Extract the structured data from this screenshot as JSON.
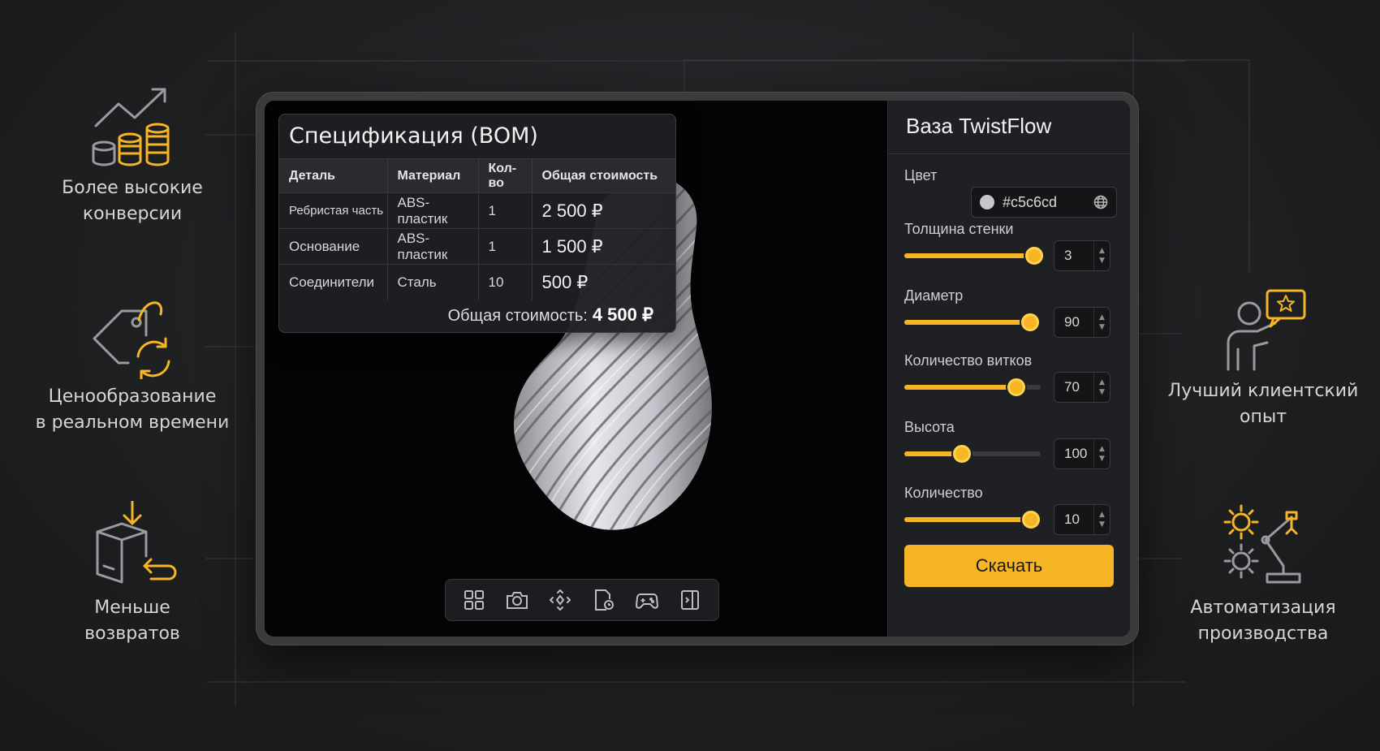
{
  "features_left": [
    {
      "label": "Более высокие\nконверсии",
      "icon": "coins-growth-icon"
    },
    {
      "label": "Ценообразование\nв реальном времени",
      "icon": "price-tag-refresh-icon"
    },
    {
      "label": "Меньше\nвозвратов",
      "icon": "box-return-icon"
    }
  ],
  "features_right": [
    {
      "label": "Лучший клиентский\nопыт",
      "icon": "customer-review-icon"
    },
    {
      "label": "Автоматизация\nпроизводства",
      "icon": "gears-robot-arm-icon"
    }
  ],
  "bom": {
    "title": "Спецификация (BOM)",
    "headers": [
      "Деталь",
      "Материал",
      "Кол-во",
      "Общая стоимость"
    ],
    "rows": [
      [
        "Ребристая часть",
        "ABS-пластик",
        "1",
        "2 500 ₽"
      ],
      [
        "Основание",
        "ABS-пластик",
        "1",
        "1 500 ₽"
      ],
      [
        "Соединители",
        "Сталь",
        "10",
        "500 ₽"
      ]
    ],
    "total_label": "Общая стоимость:",
    "total_value": "4 500 ₽"
  },
  "toolbar": [
    "grid-view-icon",
    "camera-icon",
    "move-icon",
    "document-settings-icon",
    "gamepad-icon",
    "side-panel-icon"
  ],
  "panel": {
    "title": "Ваза TwistFlow",
    "color_label": "Цвет",
    "color_value": "#c5c6cd",
    "params": [
      {
        "label": "Толщина стенки",
        "value": "3",
        "level": 0.95
      },
      {
        "label": "Диаметр",
        "value": "90",
        "level": 0.92
      },
      {
        "label": "Количество витков",
        "value": "70",
        "level": 0.82
      },
      {
        "label": "Высота",
        "value": "100",
        "level": 0.42
      },
      {
        "label": "Количество",
        "value": "10",
        "level": 0.93
      }
    ],
    "download_label": "Скачать"
  },
  "colors": {
    "accent": "#f5b524",
    "background": "#1f2022",
    "vase": "#c5c6cd"
  }
}
